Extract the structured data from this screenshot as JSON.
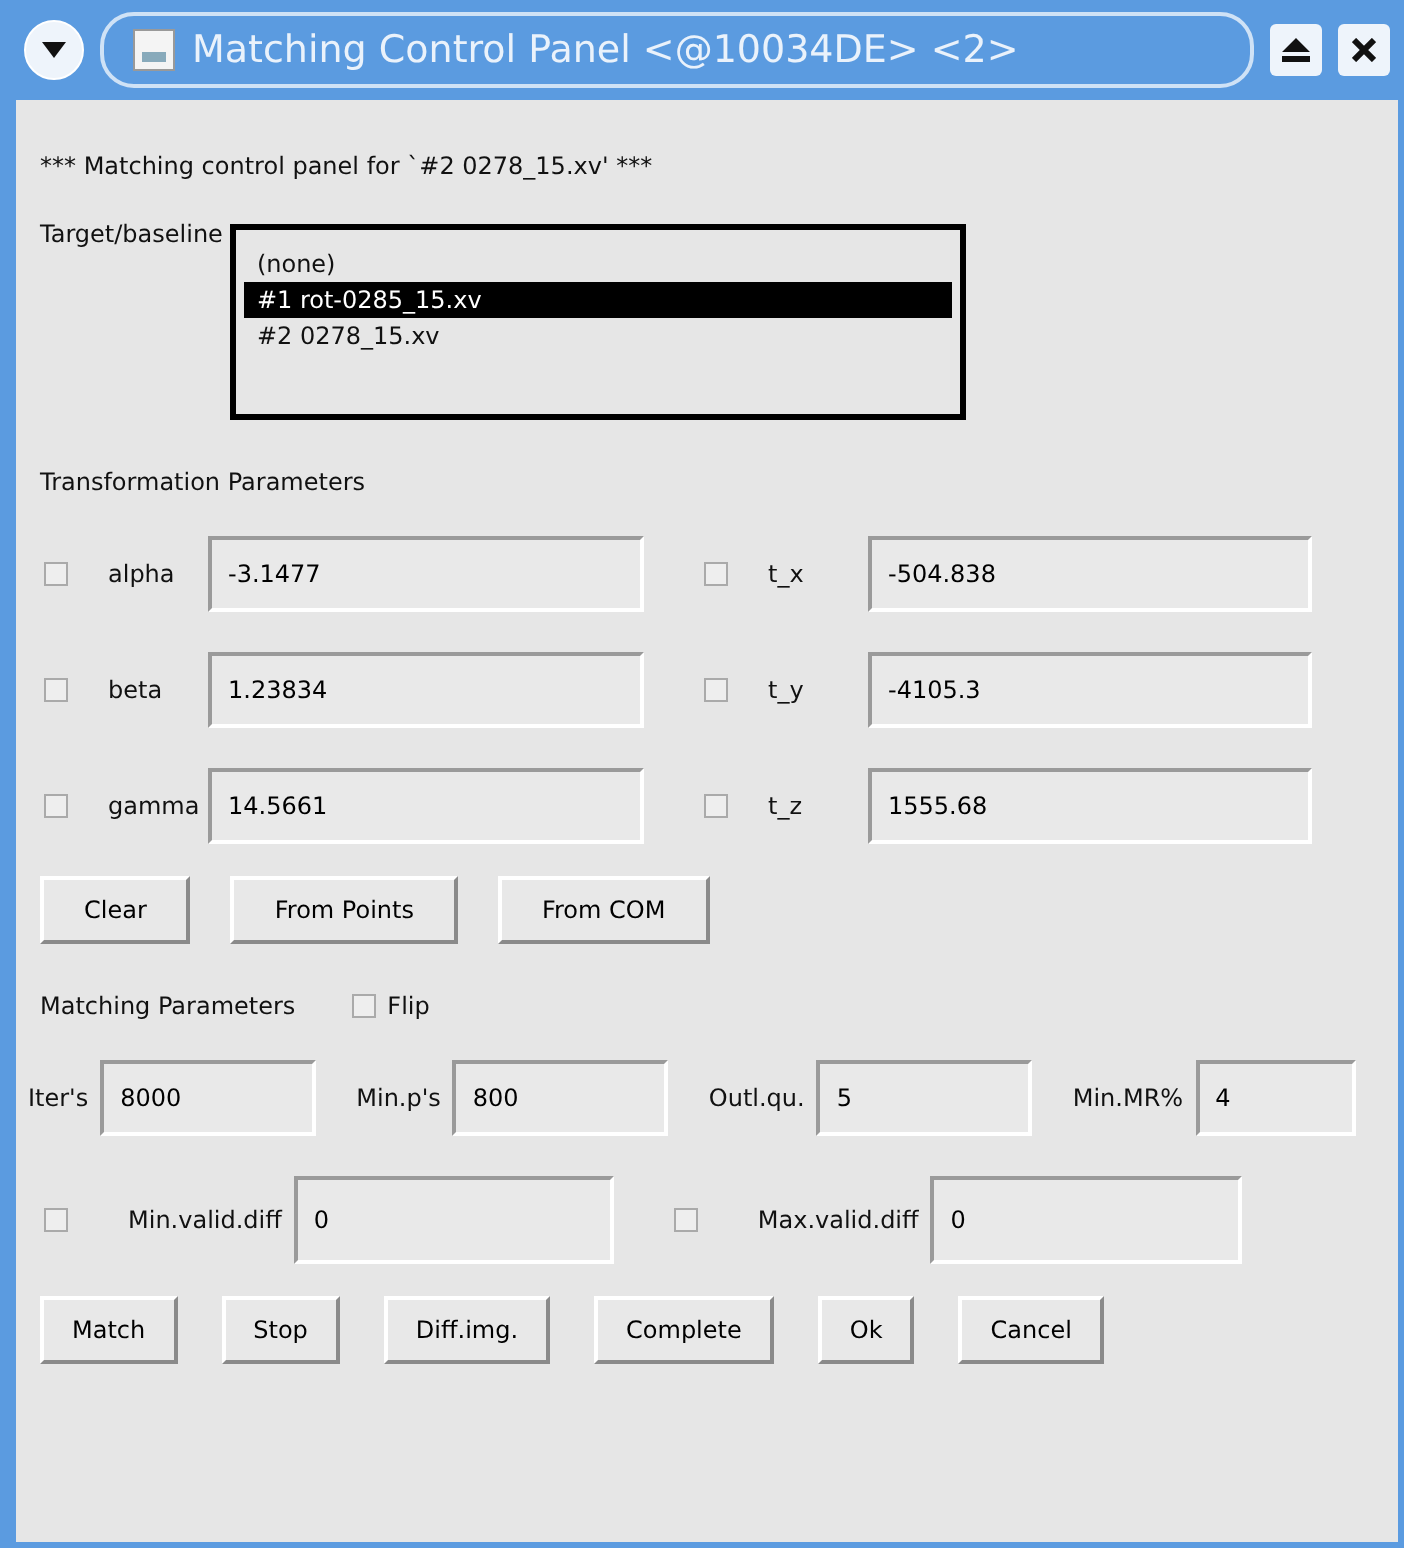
{
  "window": {
    "title": "Matching Control Panel <@10034DE> <2>"
  },
  "header": "*** Matching control panel for `#2 0278_15.xv' ***",
  "target": {
    "label": "Target/baseline",
    "items": [
      {
        "text": "(none)",
        "selected": false
      },
      {
        "text": "#1 rot-0285_15.xv",
        "selected": true
      },
      {
        "text": "#2 0278_15.xv",
        "selected": false
      }
    ]
  },
  "transformation": {
    "title": "Transformation Parameters",
    "params": [
      {
        "label": "alpha",
        "value": "-3.1477",
        "checked": false
      },
      {
        "label": "t_x",
        "value": "-504.838",
        "checked": false
      },
      {
        "label": "beta",
        "value": "1.23834",
        "checked": false
      },
      {
        "label": "t_y",
        "value": "-4105.3",
        "checked": false
      },
      {
        "label": "gamma",
        "value": "14.5661",
        "checked": false
      },
      {
        "label": "t_z",
        "value": "1555.68",
        "checked": false
      }
    ],
    "buttons": [
      "Clear",
      "From Points",
      "From COM"
    ]
  },
  "matching": {
    "title": "Matching Parameters",
    "flip": {
      "label": "Flip",
      "checked": false
    },
    "fields": [
      {
        "label": "Iter's",
        "value": "8000"
      },
      {
        "label": "Min.p's",
        "value": "800"
      },
      {
        "label": "Outl.qu.",
        "value": "5"
      },
      {
        "label": "Min.MR%",
        "value": "4"
      }
    ],
    "diffs": [
      {
        "label": "Min.valid.diff",
        "value": "0",
        "checked": false
      },
      {
        "label": "Max.valid.diff",
        "value": "0",
        "checked": false
      }
    ]
  },
  "buttons": [
    "Match",
    "Stop",
    "Diff.img.",
    "Complete",
    "Ok",
    "Cancel"
  ]
}
